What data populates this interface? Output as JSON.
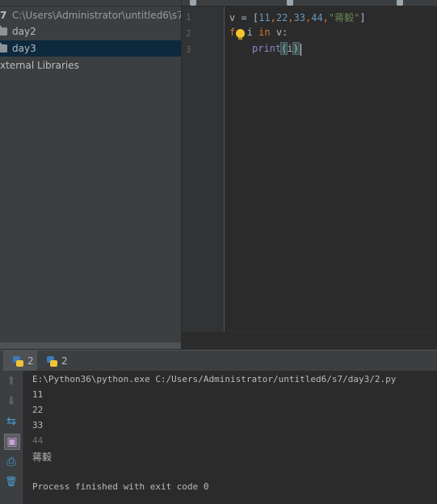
{
  "project": {
    "root_prefix": "7",
    "root_path": "C:\\Users\\Administrator\\untitled6\\s7",
    "items": [
      {
        "label": "day2",
        "selected": false
      },
      {
        "label": "day3",
        "selected": true
      }
    ],
    "external_libraries": "xternal Libraries"
  },
  "editor": {
    "line_numbers": [
      "1",
      "2",
      "3"
    ],
    "line1": {
      "var": "v",
      "eq": " = ",
      "open": "[",
      "n1": "11",
      "c1": ",",
      "n2": "22",
      "c2": ",",
      "n3": "33",
      "c3": ",",
      "n4": "44",
      "c4": ",",
      "str": "\"蒋毅\"",
      "close": "]"
    },
    "line2": {
      "kw_for": "f",
      "mid": "  i ",
      "kw_in": "in",
      "end": " v:"
    },
    "line3": {
      "fn": "print",
      "open": "(",
      "arg": "i",
      "close": ")"
    }
  },
  "run": {
    "tabs": [
      {
        "label": "2",
        "icon": "python-icon",
        "active": true
      },
      {
        "label": "2",
        "icon": "python-icon",
        "active": false
      }
    ],
    "toolbar": [
      {
        "name": "scroll-up-icon",
        "glyph": "⬆"
      },
      {
        "name": "scroll-down-icon",
        "glyph": "⬇"
      },
      {
        "name": "soft-wrap-icon",
        "glyph": "⇆"
      },
      {
        "name": "scroll-to-end-icon",
        "glyph": "▣"
      },
      {
        "name": "print-icon",
        "glyph": "⎙"
      },
      {
        "name": "trash-icon",
        "glyph": "🗑"
      }
    ],
    "console": {
      "command": "E:\\Python36\\python.exe C:/Users/Administrator/untitled6/s7/day3/2.py",
      "outputs": [
        "11",
        "22",
        "33",
        "44",
        "蒋毅"
      ],
      "finished": "Process finished with exit code 0"
    }
  },
  "colors": {
    "panel_bg": "#3c3f41",
    "editor_bg": "#2b2b2b",
    "selection": "#0d293e",
    "keyword": "#cc7832",
    "number": "#6897bb",
    "string": "#6a8759"
  }
}
